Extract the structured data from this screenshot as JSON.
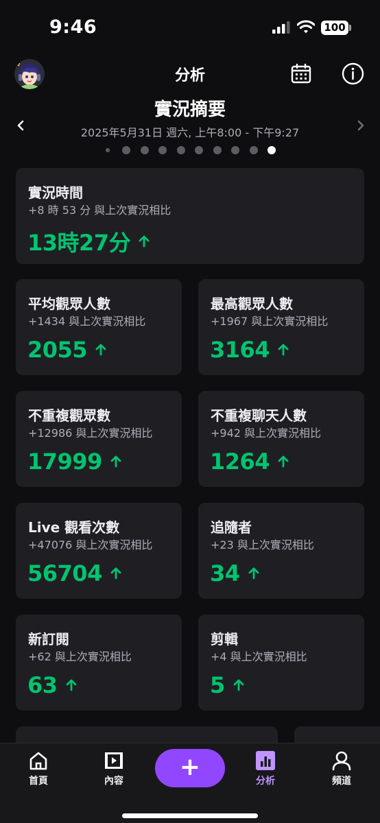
{
  "status_bar": {
    "time": "9:46",
    "battery": "100"
  },
  "header": {
    "title": "分析"
  },
  "summary": {
    "title": "實況摘要",
    "range": "2025年5月31日 週六, 上午8:00 - 下午9:27",
    "page_count": 10,
    "active_page": 10
  },
  "cards": [
    {
      "label": "實況時間",
      "delta": "+8 時 53 分 與上次實況相比",
      "value": "13時27分"
    },
    {
      "label": "平均觀眾人數",
      "delta": "+1434 與上次實況相比",
      "value": "2055"
    },
    {
      "label": "最高觀眾人數",
      "delta": "+1967 與上次實況相比",
      "value": "3164"
    },
    {
      "label": "不重複觀眾數",
      "delta": "+12986 與上次實況相比",
      "value": "17999"
    },
    {
      "label": "不重複聊天人數",
      "delta": "+942 與上次實況相比",
      "value": "1264"
    },
    {
      "label": "Live 觀看次數",
      "delta": "+47076 與上次實況相比",
      "value": "56704"
    },
    {
      "label": "追隨者",
      "delta": "+23 與上次實況相比",
      "value": "34"
    },
    {
      "label": "新訂閱",
      "delta": "+62 與上次實況相比",
      "value": "63"
    },
    {
      "label": "剪輯",
      "delta": "+4 與上次實況相比",
      "value": "5"
    }
  ],
  "bottom_nav": {
    "home": "首頁",
    "content": "內容",
    "create": "+",
    "analytics": "分析",
    "channel": "頻道",
    "active": "analytics"
  },
  "colors": {
    "background": "#0e0e10",
    "card": "#1f1f23",
    "positive": "#00c46f",
    "accent": "#9147ff",
    "active_tab": "#bf94ff"
  },
  "icons": {
    "header": [
      "avatar",
      "calendar-icon",
      "info-icon"
    ],
    "nav": [
      "home-icon",
      "content-icon",
      "analytics-icon",
      "profile-icon"
    ]
  }
}
